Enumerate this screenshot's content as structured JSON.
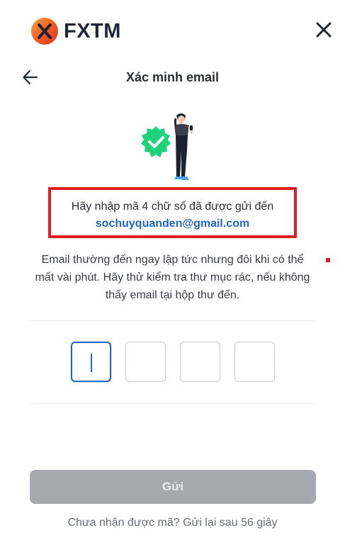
{
  "brand": {
    "name": "FXTM",
    "accent": "#ef5a24"
  },
  "header": {
    "title": "Xác minh email",
    "back_icon": "arrow-left-icon",
    "close_icon": "close-icon"
  },
  "message": {
    "line1": "Hãy nhập mã 4 chữ số đã được gửi đến",
    "email": "sochuyquanden@gmail.com",
    "highlight_color": "#e01c24"
  },
  "description": {
    "line1": "Email thường đến ngay lập tức nhưng đôi khi có thể",
    "line2": "mất vài phút. Hãy thử kiểm tra thư mục rác, nếu không",
    "line3": "thấy email tại hộp thư đến."
  },
  "code": {
    "digits": [
      "",
      "",
      "",
      ""
    ],
    "active_index": 0,
    "active_color": "#1f67c4"
  },
  "actions": {
    "submit_label": "Gửi",
    "submit_enabled": false,
    "resend_text": "Chưa nhận được mã? Gửi lại sau 56 giây"
  }
}
